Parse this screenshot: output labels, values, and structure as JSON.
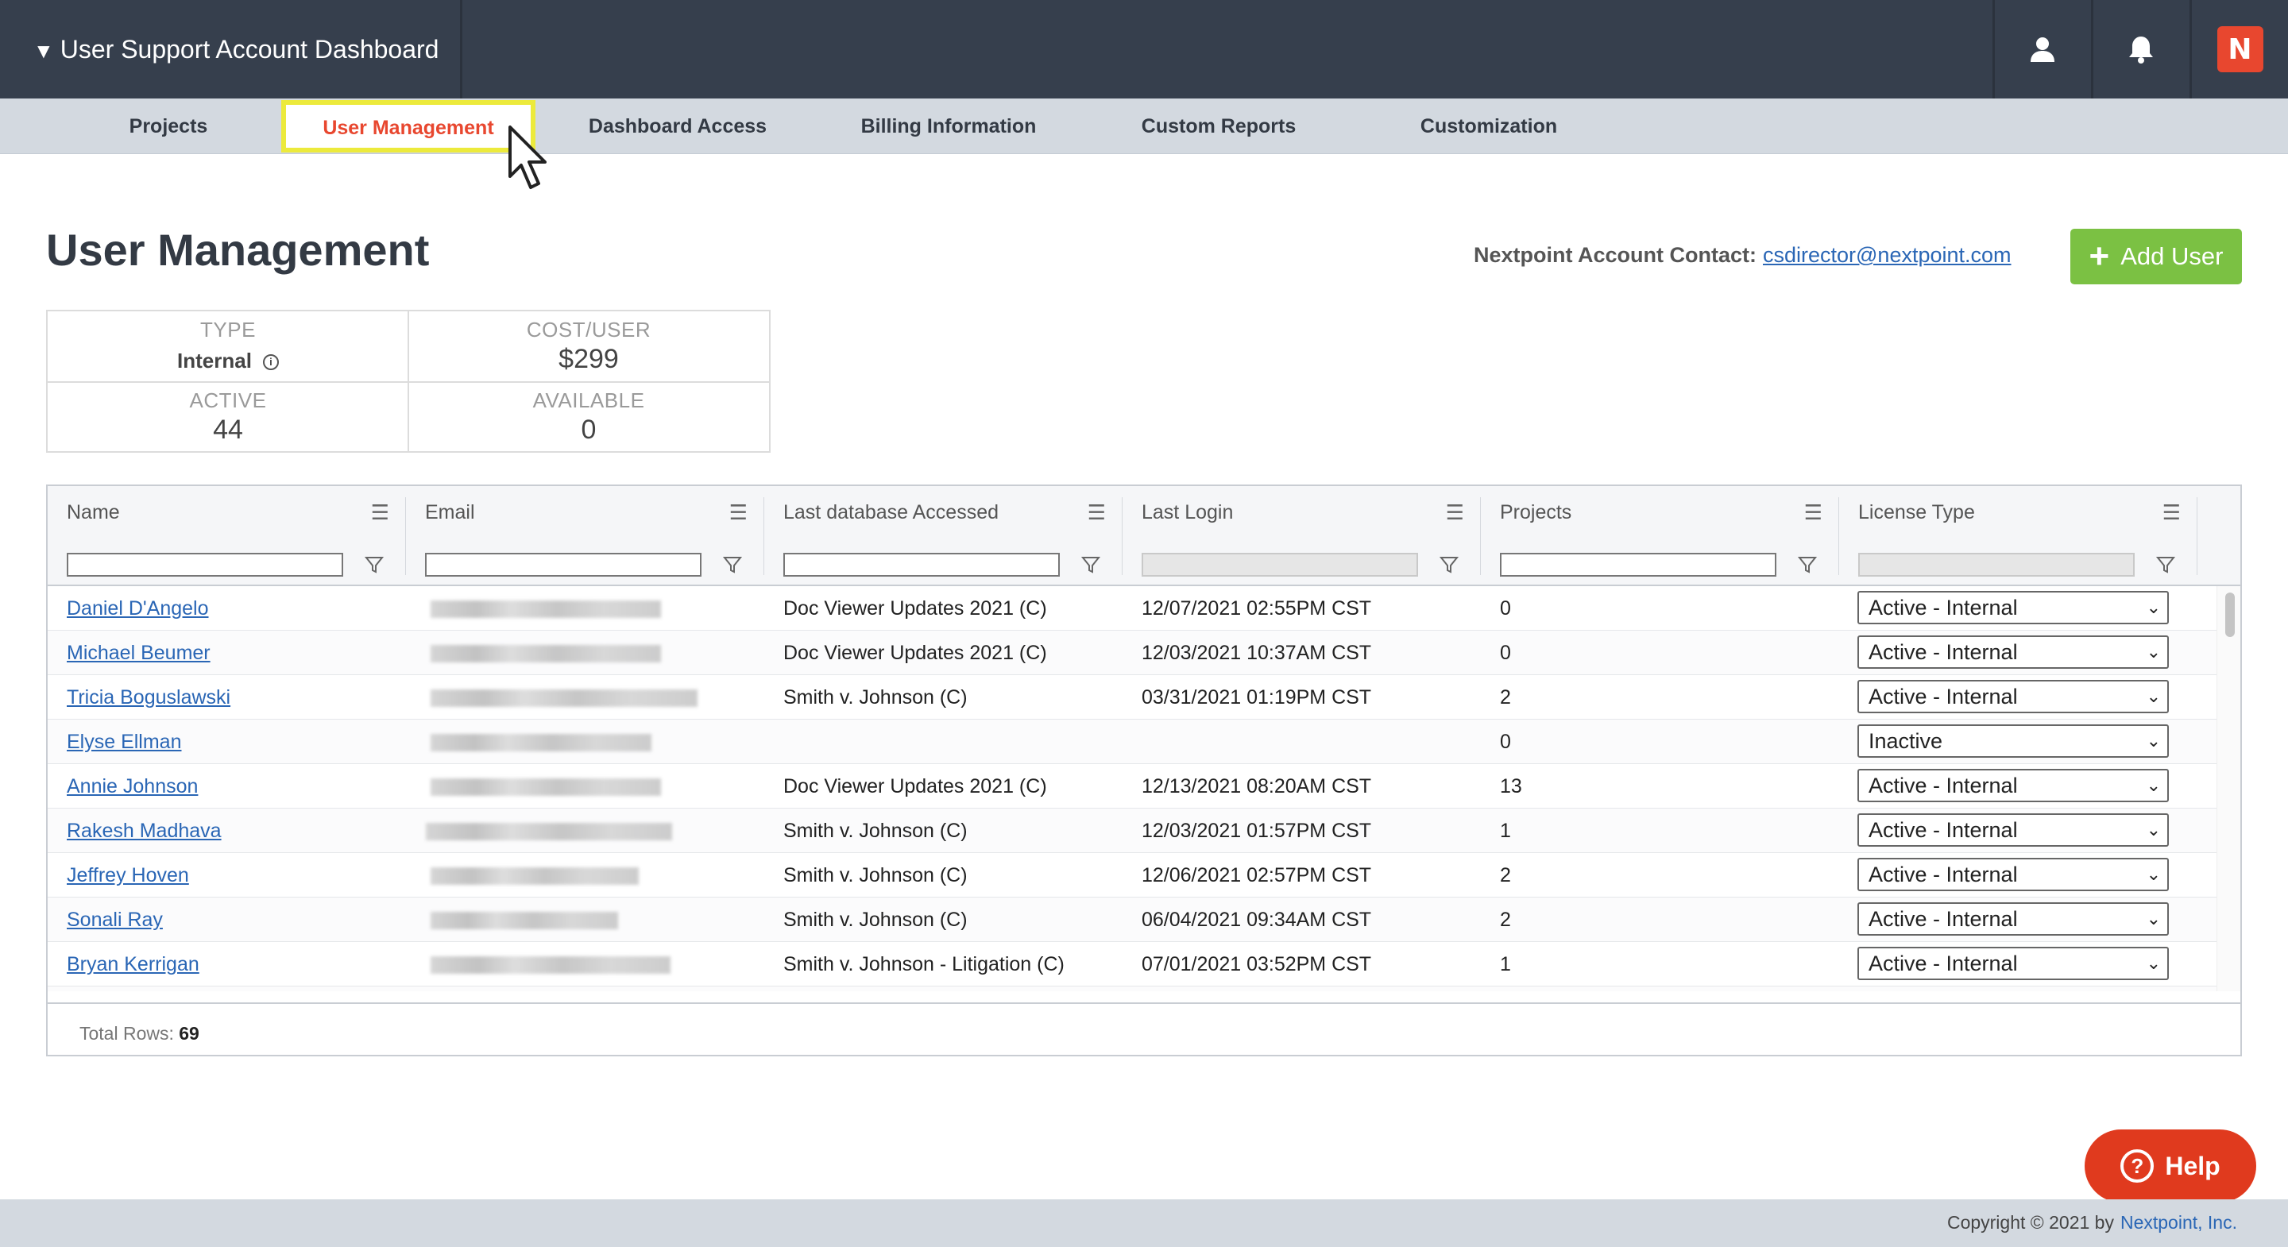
{
  "header": {
    "title": "User Support Account Dashboard",
    "caret": "▼",
    "logo_glyph": "N",
    "icons": [
      "user-icon",
      "bell-icon",
      "nextpoint-logo-icon"
    ],
    "colors": {
      "header_bg": "#363f4d",
      "accent": "#e8472f",
      "logo_bg": "#e8472f"
    }
  },
  "tabs": [
    {
      "label": "Projects"
    },
    {
      "label": "User Management",
      "active": true
    },
    {
      "label": "Dashboard Access"
    },
    {
      "label": "Billing Information"
    },
    {
      "label": "Custom Reports"
    },
    {
      "label": "Customization"
    }
  ],
  "page": {
    "title": "User Management",
    "contact_label": "Nextpoint Account Contact:",
    "contact_email": "csdirector@nextpoint.com",
    "add_user_label": "Add User",
    "add_user_color": "#7bc143"
  },
  "stats": {
    "type_label": "TYPE",
    "type_value": "Internal",
    "cost_label": "COST/USER",
    "cost_value": "$299",
    "active_label": "ACTIVE",
    "active_value": "44",
    "available_label": "AVAILABLE",
    "available_value": "0"
  },
  "grid": {
    "columns": [
      "Name",
      "Email",
      "Last database Accessed",
      "Last Login",
      "Projects",
      "License Type"
    ],
    "rows": [
      {
        "name": "Daniel D'Angelo",
        "database": "Doc Viewer Updates 2021 (C)",
        "last_login": "12/07/2021 02:55PM CST",
        "projects": "0",
        "license": "Active - Internal"
      },
      {
        "name": "Michael Beumer",
        "database": "Doc Viewer Updates 2021 (C)",
        "last_login": "12/03/2021 10:37AM CST",
        "projects": "0",
        "license": "Active - Internal"
      },
      {
        "name": "Tricia Boguslawski",
        "database": "Smith v. Johnson (C)",
        "last_login": "03/31/2021 01:19PM CST",
        "projects": "2",
        "license": "Active - Internal"
      },
      {
        "name": "Elyse Ellman",
        "database": "",
        "last_login": "",
        "projects": "0",
        "license": "Inactive"
      },
      {
        "name": "Annie Johnson",
        "database": "Doc Viewer Updates 2021 (C)",
        "last_login": "12/13/2021 08:20AM CST",
        "projects": "13",
        "license": "Active - Internal"
      },
      {
        "name": "Rakesh Madhava",
        "database": "Smith v. Johnson (C)",
        "last_login": "12/03/2021 01:57PM CST",
        "projects": "1",
        "license": "Active - Internal"
      },
      {
        "name": "Jeffrey Hoven",
        "database": "Smith v. Johnson (C)",
        "last_login": "12/06/2021 02:57PM CST",
        "projects": "2",
        "license": "Active - Internal"
      },
      {
        "name": "Sonali Ray",
        "database": "Smith v. Johnson (C)",
        "last_login": "06/04/2021 09:34AM CST",
        "projects": "2",
        "license": "Active - Internal"
      },
      {
        "name": "Bryan Kerrigan",
        "database": "Smith v. Johnson - Litigation (C)",
        "last_login": "07/01/2021 03:52PM CST",
        "projects": "1",
        "license": "Active - Internal"
      }
    ],
    "total_label": "Total Rows:",
    "total_value": "69"
  },
  "help": {
    "label": "Help",
    "icon": "question-icon"
  },
  "footer": {
    "copyright": "Copyright © 2021 by",
    "brand": "Nextpoint, Inc."
  }
}
